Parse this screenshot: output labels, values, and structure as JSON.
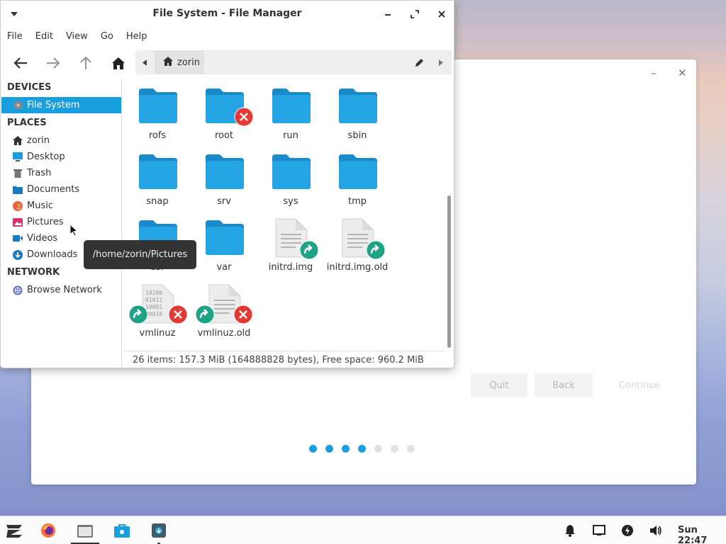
{
  "installer": {
    "buttons": {
      "quit": "Quit",
      "back": "Back",
      "continue": "Continue"
    },
    "progress_dots": [
      true,
      true,
      true,
      true,
      false,
      false,
      false
    ]
  },
  "window": {
    "title": "File System - File Manager",
    "menu": [
      "File",
      "Edit",
      "View",
      "Go",
      "Help"
    ],
    "path": {
      "current": "zorin"
    }
  },
  "sidebar": {
    "devices_heading": "DEVICES",
    "devices": [
      {
        "label": "File System",
        "icon": "harddisk-icon",
        "selected": true
      }
    ],
    "places_heading": "PLACES",
    "places": [
      {
        "label": "zorin",
        "icon": "home-icon"
      },
      {
        "label": "Desktop",
        "icon": "desktop-icon"
      },
      {
        "label": "Trash",
        "icon": "trash-icon"
      },
      {
        "label": "Documents",
        "icon": "documents-icon"
      },
      {
        "label": "Music",
        "icon": "music-icon"
      },
      {
        "label": "Pictures",
        "icon": "pictures-icon"
      },
      {
        "label": "Videos",
        "icon": "videos-icon"
      },
      {
        "label": "Downloads",
        "icon": "downloads-icon"
      }
    ],
    "network_heading": "NETWORK",
    "network": [
      {
        "label": "Browse Network",
        "icon": "network-icon"
      }
    ]
  },
  "files": [
    {
      "name": "rofs",
      "type": "folder"
    },
    {
      "name": "root",
      "type": "folder",
      "emblem": "unreadable"
    },
    {
      "name": "run",
      "type": "folder"
    },
    {
      "name": "sbin",
      "type": "folder"
    },
    {
      "name": "snap",
      "type": "folder"
    },
    {
      "name": "srv",
      "type": "folder"
    },
    {
      "name": "sys",
      "type": "folder"
    },
    {
      "name": "tmp",
      "type": "folder"
    },
    {
      "name": "usr",
      "type": "folder"
    },
    {
      "name": "var",
      "type": "folder"
    },
    {
      "name": "initrd.img",
      "type": "file-link"
    },
    {
      "name": "initrd.img.old",
      "type": "file-link"
    },
    {
      "name": "vmlinuz",
      "type": "binary-link-unreadable"
    },
    {
      "name": "vmlinuz.old",
      "type": "file-link-unreadable"
    }
  ],
  "status": "26 items: 157.3 MiB (164888828 bytes), Free space: 960.2 MiB",
  "tooltip": "/home/zorin/Pictures",
  "taskbar": {
    "clock": "Sun 22:47",
    "colors": {
      "accent": "#1a9fde",
      "folder": "#25a4e4"
    }
  }
}
